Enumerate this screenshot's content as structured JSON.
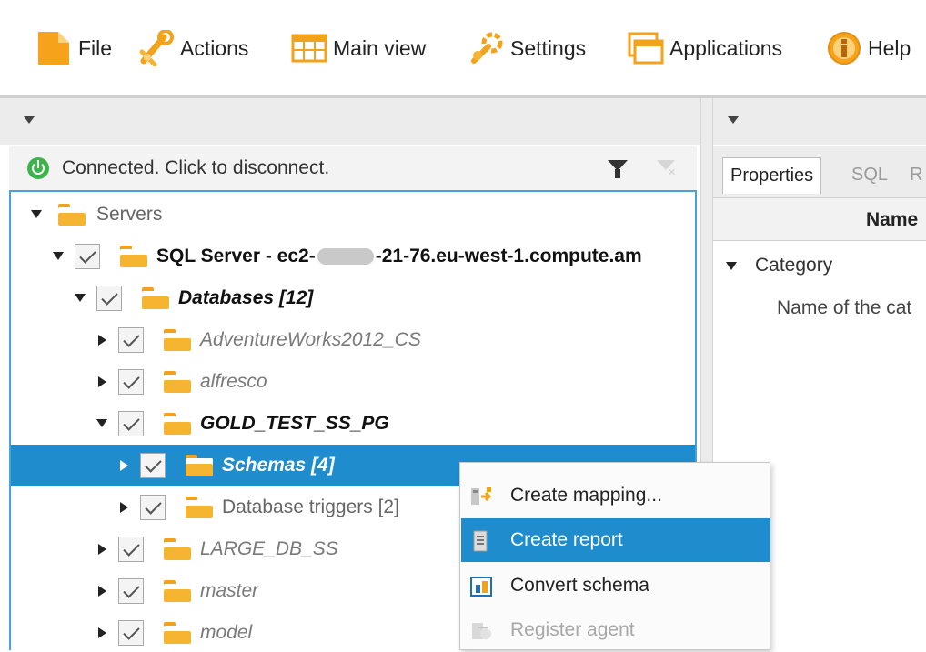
{
  "menubar": {
    "items": [
      {
        "label": "File",
        "icon": "file-icon"
      },
      {
        "label": "Actions",
        "icon": "actions-icon"
      },
      {
        "label": "Main view",
        "icon": "main-view-icon"
      },
      {
        "label": "Settings",
        "icon": "settings-icon"
      },
      {
        "label": "Applications",
        "icon": "applications-icon"
      },
      {
        "label": "Help",
        "icon": "help-icon"
      }
    ]
  },
  "left_panel": {
    "status": "Connected. Click to disconnect.",
    "tree": {
      "servers": "Servers",
      "server_prefix": "SQL Server - ec2-",
      "server_suffix": "-21-76.eu-west-1.compute.am",
      "databases": "Databases [12]",
      "db_adventure": "AdventureWorks2012_CS",
      "db_alfresco": "alfresco",
      "db_gold": "GOLD_TEST_SS_PG",
      "schemas": "Schemas [4]",
      "db_triggers": "Database triggers [2]",
      "db_large": "LARGE_DB_SS",
      "db_master": "master",
      "db_model": "model"
    }
  },
  "right_panel": {
    "tabs": [
      "Properties",
      "SQL",
      "R"
    ],
    "column_header": "Name",
    "category_label": "Category",
    "category_description": "Name of the cat"
  },
  "context_menu": {
    "items": [
      {
        "label": "Create mapping...",
        "state": "normal"
      },
      {
        "label": "Create report",
        "state": "highlighted"
      },
      {
        "label": "Convert schema",
        "state": "normal"
      },
      {
        "label": "Register agent",
        "state": "disabled"
      }
    ]
  },
  "colors": {
    "selection": "#1f8dcd",
    "folder": "#f6b531",
    "connected": "#3cb44b",
    "tree_border": "#4aa3d8"
  }
}
